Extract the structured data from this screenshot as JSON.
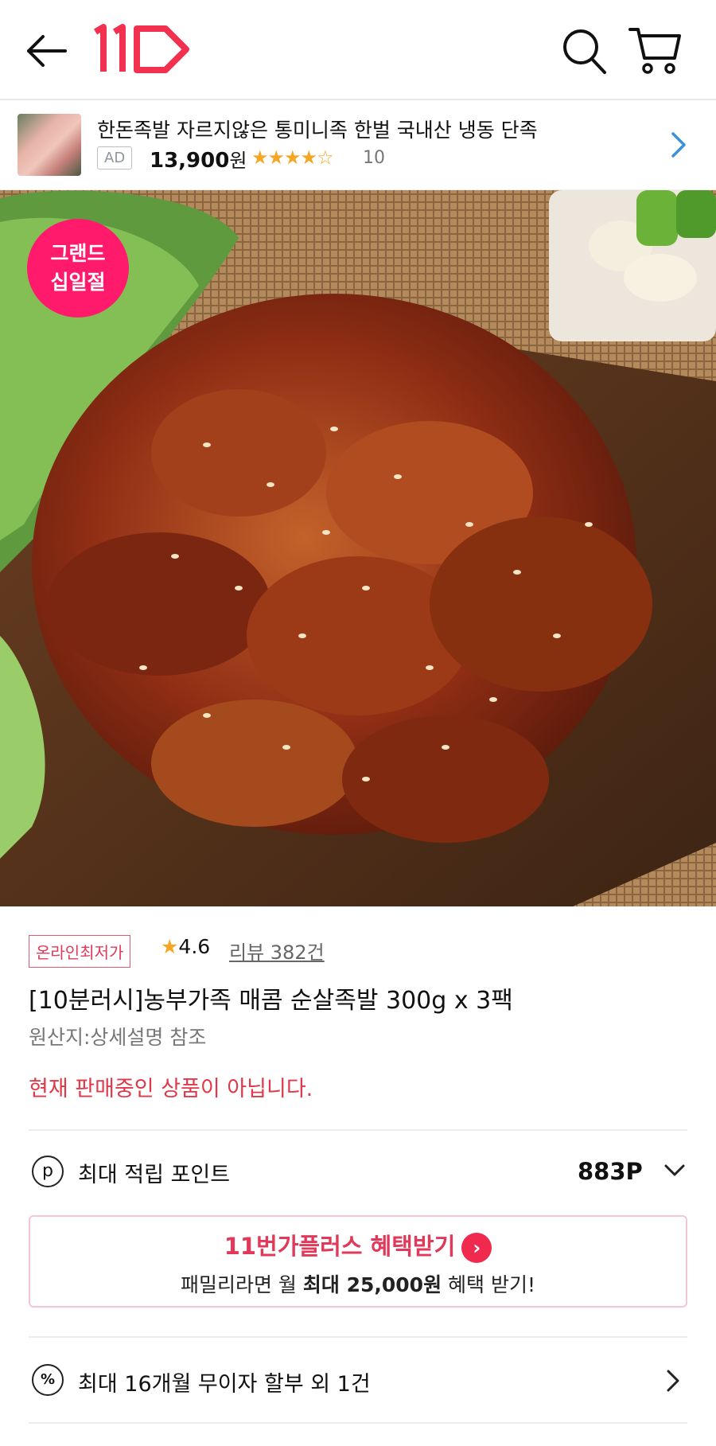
{
  "header": {
    "back_icon": "arrow-left-icon",
    "logo_text": "11번가",
    "search_icon": "search-icon",
    "cart_icon": "cart-icon"
  },
  "ad": {
    "title": "한돈족발 자르지않은 통미니족 한벌 국내산 냉동 단족",
    "badge": "AD",
    "price": "13,900",
    "price_unit": "원",
    "stars": "★★★★☆",
    "rating_value": 4.5,
    "review_count": "10"
  },
  "hero": {
    "badge_line1": "그랜드",
    "badge_line2": "십일절"
  },
  "product": {
    "tag": "온라인최저가",
    "rating": "4.6",
    "review_label": "리뷰 382건",
    "title": "[10분러시]농부가족 매콤 순살족발 300g x 3팩",
    "origin": "원산지:상세설명 참조",
    "notice": "현재 판매중인 상품이 아닙니다."
  },
  "points": {
    "icon_char": "p",
    "label": "최대 적립 포인트",
    "value": "883P"
  },
  "plus": {
    "headline": "11번가플러스 혜택받기",
    "sub_pre": "패밀리라면 월 ",
    "sub_bold": "최대 25,000원",
    "sub_post": " 혜택 받기!"
  },
  "installment": {
    "icon_char": "%",
    "label": "최대 16개월 무이자 할부 외 1건"
  },
  "colors": {
    "brand": "#e0395a",
    "badge": "#ff1a6b",
    "star": "#f5a623"
  }
}
